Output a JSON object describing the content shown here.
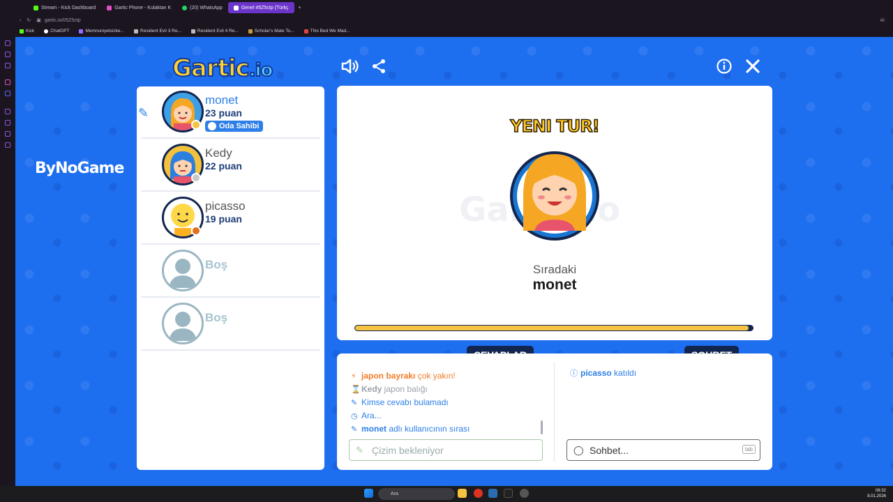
{
  "browser": {
    "tabs": [
      {
        "label": "Stream - Kick Dashboard",
        "color": "#53fc18"
      },
      {
        "label": "Gartic Phone - Kulaktan K",
        "color": "#e04fbf"
      },
      {
        "label": "(20) WhatsApp",
        "color": "#25d366"
      },
      {
        "label": "Genel #5Z5ctp (Türkç",
        "color": "#ffffff",
        "active": true
      }
    ],
    "add_tab": "+",
    "url": "gartic.io/05Z5ctp",
    "ai_label": "AI",
    "bookmarks": [
      {
        "label": "Kick",
        "color": "#53fc18"
      },
      {
        "label": "ChatGPT",
        "color": "#ffffff"
      },
      {
        "label": "Memnuniyetsizke...",
        "color": "#9b6bff"
      },
      {
        "label": "Resident Evil 3 Re...",
        "color": "#bbbbbb"
      },
      {
        "label": "Resident Evil 4 Re...",
        "color": "#bbbbbb"
      },
      {
        "label": "Scholar's Mate To...",
        "color": "#c79b3a"
      },
      {
        "label": "This Bed We Mad...",
        "color": "#d44"
      }
    ]
  },
  "game": {
    "logo_main": "Gartic",
    "logo_suffix": ".io",
    "watermark": "ByNoGame",
    "players": [
      {
        "name": "monet",
        "score": "23 puan",
        "badge": "Oda Sahibi",
        "name_color": "#2d7ee8",
        "dot": "#f5c242"
      },
      {
        "name": "Kedy",
        "score": "22 puan",
        "name_color": "#555555",
        "dot": "#c8c8c8"
      },
      {
        "name": "picasso",
        "score": "19 puan",
        "name_color": "#555555",
        "dot": "#e0701e"
      },
      {
        "name": "Boş",
        "empty": true
      },
      {
        "name": "Boş",
        "empty": true
      }
    ],
    "board": {
      "new_round": "YENI TUR!",
      "next_label": "Sıradaki",
      "next_name": "monet",
      "progress": 0.99
    },
    "answers_tab": "CEVAPLAR",
    "chat_tab": "SOHBET",
    "answers": [
      {
        "icon": "lightning",
        "strong": "japon bayrakı",
        "text": " çok yakın!",
        "color": "#f07c2a"
      },
      {
        "icon": "hourglass",
        "strong": "Kedy",
        "text": " japon balığı",
        "color": "#9aa0aa"
      },
      {
        "icon": "pencil",
        "strong": "",
        "text": "Kimse cevabı bulamadı",
        "color": "#2d7ee8"
      },
      {
        "icon": "clock",
        "strong": "",
        "text": "Ara...",
        "color": "#2d7ee8"
      },
      {
        "icon": "pencil",
        "strong": "monet",
        "text": " adlı kullanıcının sırası",
        "color": "#2d7ee8"
      }
    ],
    "answer_input_placeholder": "Çizim bekleniyor",
    "chat_messages": [
      {
        "strong": "picasso",
        "text": " katıldı"
      }
    ],
    "chat_input_placeholder": "Sohbet...",
    "chat_tab_hint": "tab"
  },
  "taskbar": {
    "search": "Ara",
    "time": "06:32",
    "date": "8.01.2026"
  }
}
